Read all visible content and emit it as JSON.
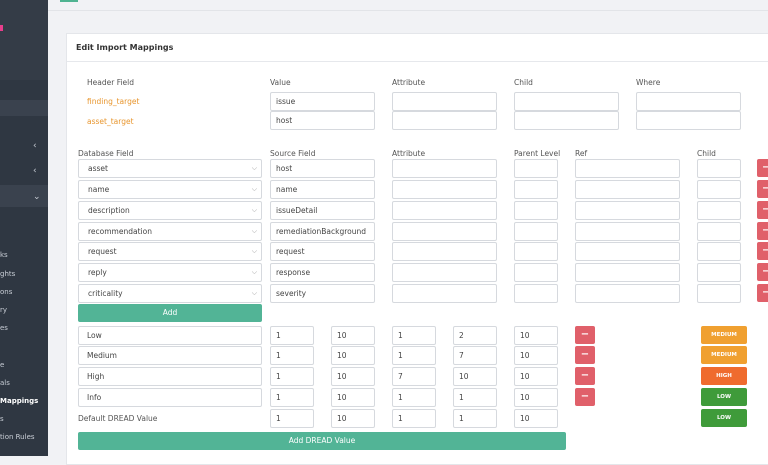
{
  "sidebar": {
    "items": [
      "ks",
      "ghts",
      "ons",
      "ry",
      "es",
      "e",
      "als",
      "Mappings",
      "s",
      "tion Rules"
    ]
  },
  "card": {
    "title": "Edit Import Mappings"
  },
  "header_section": {
    "columns": [
      "Header Field",
      "Value",
      "Attribute",
      "Child",
      "Where"
    ],
    "rows": [
      {
        "field": "finding_target",
        "value": "issue"
      },
      {
        "field": "asset_target",
        "value": "host"
      }
    ]
  },
  "db_section": {
    "columns": [
      "Database Field",
      "Source Field",
      "Attribute",
      "Parent Level",
      "Ref",
      "Child"
    ],
    "rows": [
      {
        "db_field": "asset",
        "source": "host"
      },
      {
        "db_field": "name",
        "source": "name"
      },
      {
        "db_field": "description",
        "source": "issueDetail"
      },
      {
        "db_field": "recommendation",
        "source": "remediationBackground"
      },
      {
        "db_field": "request",
        "source": "request"
      },
      {
        "db_field": "reply",
        "source": "response"
      },
      {
        "db_field": "criticality",
        "source": "severity"
      }
    ],
    "add_label": "Add",
    "delete_label": "−"
  },
  "dread_section": {
    "rows": [
      {
        "name": "Low",
        "values": [
          "1",
          "10",
          "1",
          "2",
          "10"
        ],
        "badge": "MEDIUM",
        "badge_color": "#f0a030"
      },
      {
        "name": "Medium",
        "values": [
          "1",
          "10",
          "1",
          "7",
          "10"
        ],
        "badge": "MEDIUM",
        "badge_color": "#f0a030"
      },
      {
        "name": "High",
        "values": [
          "1",
          "10",
          "7",
          "10",
          "10"
        ],
        "badge": "HIGH",
        "badge_color": "#ef6b2e"
      },
      {
        "name": "Info",
        "values": [
          "1",
          "10",
          "1",
          "1",
          "10"
        ],
        "badge": "LOW",
        "badge_color": "#3f9b3a"
      }
    ],
    "default_label": "Default DREAD Value",
    "default_values": [
      "1",
      "10",
      "1",
      "1",
      "10"
    ],
    "default_badge": "LOW",
    "default_badge_color": "#3f9b3a",
    "add_label": "Add DREAD Value"
  }
}
